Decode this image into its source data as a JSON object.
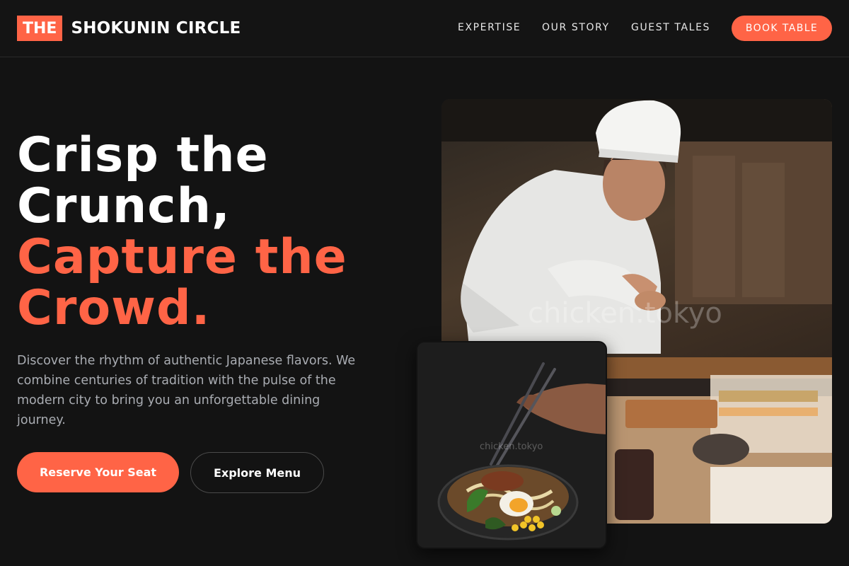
{
  "brand": {
    "badge": "THE",
    "name": "SHOKUNIN CIRCLE",
    "accent_color": "#ff6446"
  },
  "nav": {
    "items": [
      {
        "label": "EXPERTISE"
      },
      {
        "label": "OUR STORY"
      },
      {
        "label": "GUEST TALES"
      }
    ],
    "cta_label": "BOOK TABLE"
  },
  "hero": {
    "title_lines": [
      "Crisp the",
      "Crunch,"
    ],
    "title_accent_lines": [
      "Capture the",
      "Crowd."
    ],
    "description": "Discover the rhythm of authentic Japanese flavors. We combine centuries of tradition with the pulse of the modern city to bring you an unforgettable dining journey.",
    "primary_button": "Reserve Your Seat",
    "secondary_button": "Explore Menu"
  },
  "images": {
    "chef_watermark": "chicken.tokyo",
    "bowl_watermark": "chicken.tokyo"
  }
}
